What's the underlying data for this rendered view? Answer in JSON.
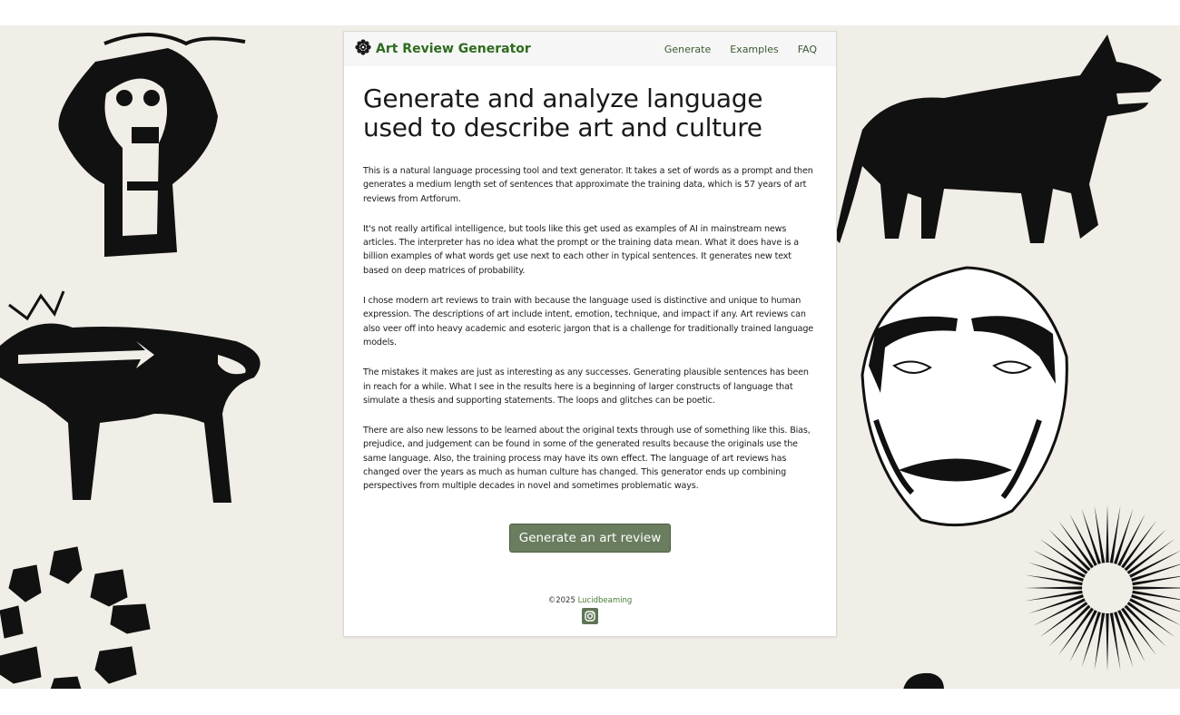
{
  "header": {
    "brand_title": "Art Review Generator",
    "nav": [
      "Generate",
      "Examples",
      "FAQ"
    ]
  },
  "main": {
    "heading": "Generate and analyze language used to describe art and culture",
    "paragraphs": [
      "This is a natural language processing tool and text generator. It takes a set of words as a prompt and then generates a medium length set of sentences that approximate the training data, which is 57 years of art reviews from Artforum.",
      "It's not really artifical intelligence, but tools like this get used as examples of AI in mainstream news articles. The interpreter has no idea what the prompt or the training data mean. What it does have is a billion examples of what words get use next to each other in typical sentences. It generates new text based on deep matrices of probability.",
      "I chose modern art reviews to train with because the language used is distinctive and unique to human expression. The descriptions of art include intent, emotion, technique, and impact if any. Art reviews can also veer off into heavy academic and esoteric jargon that is a challenge for traditionally trained language models.",
      "The mistakes it makes are just as interesting as any successes. Generating plausible sentences has been in reach for a while. What I see in the results here is a beginning of larger constructs of language that simulate a thesis and supporting statements. The loops and glitches can be poetic.",
      "There are also new lessons to be learned about the original texts through use of something like this. Bias, prejudice, and judgement can be found in some of the generated results because the originals use the same language. Also, the training process may have its own effect. The language of art reviews has changed over the years as much as human culture has changed. This generator ends up combining perspectives from multiple decades in novel and sometimes problematic ways."
    ],
    "cta_label": "Generate an art review"
  },
  "footer": {
    "copyright": "©2025",
    "author_link": "Lucidbeaming",
    "social_icon": "instagram-icon"
  },
  "colors": {
    "brand": "#2e6b1f",
    "button": "#6a7d5f",
    "background": "#f1ede7"
  }
}
